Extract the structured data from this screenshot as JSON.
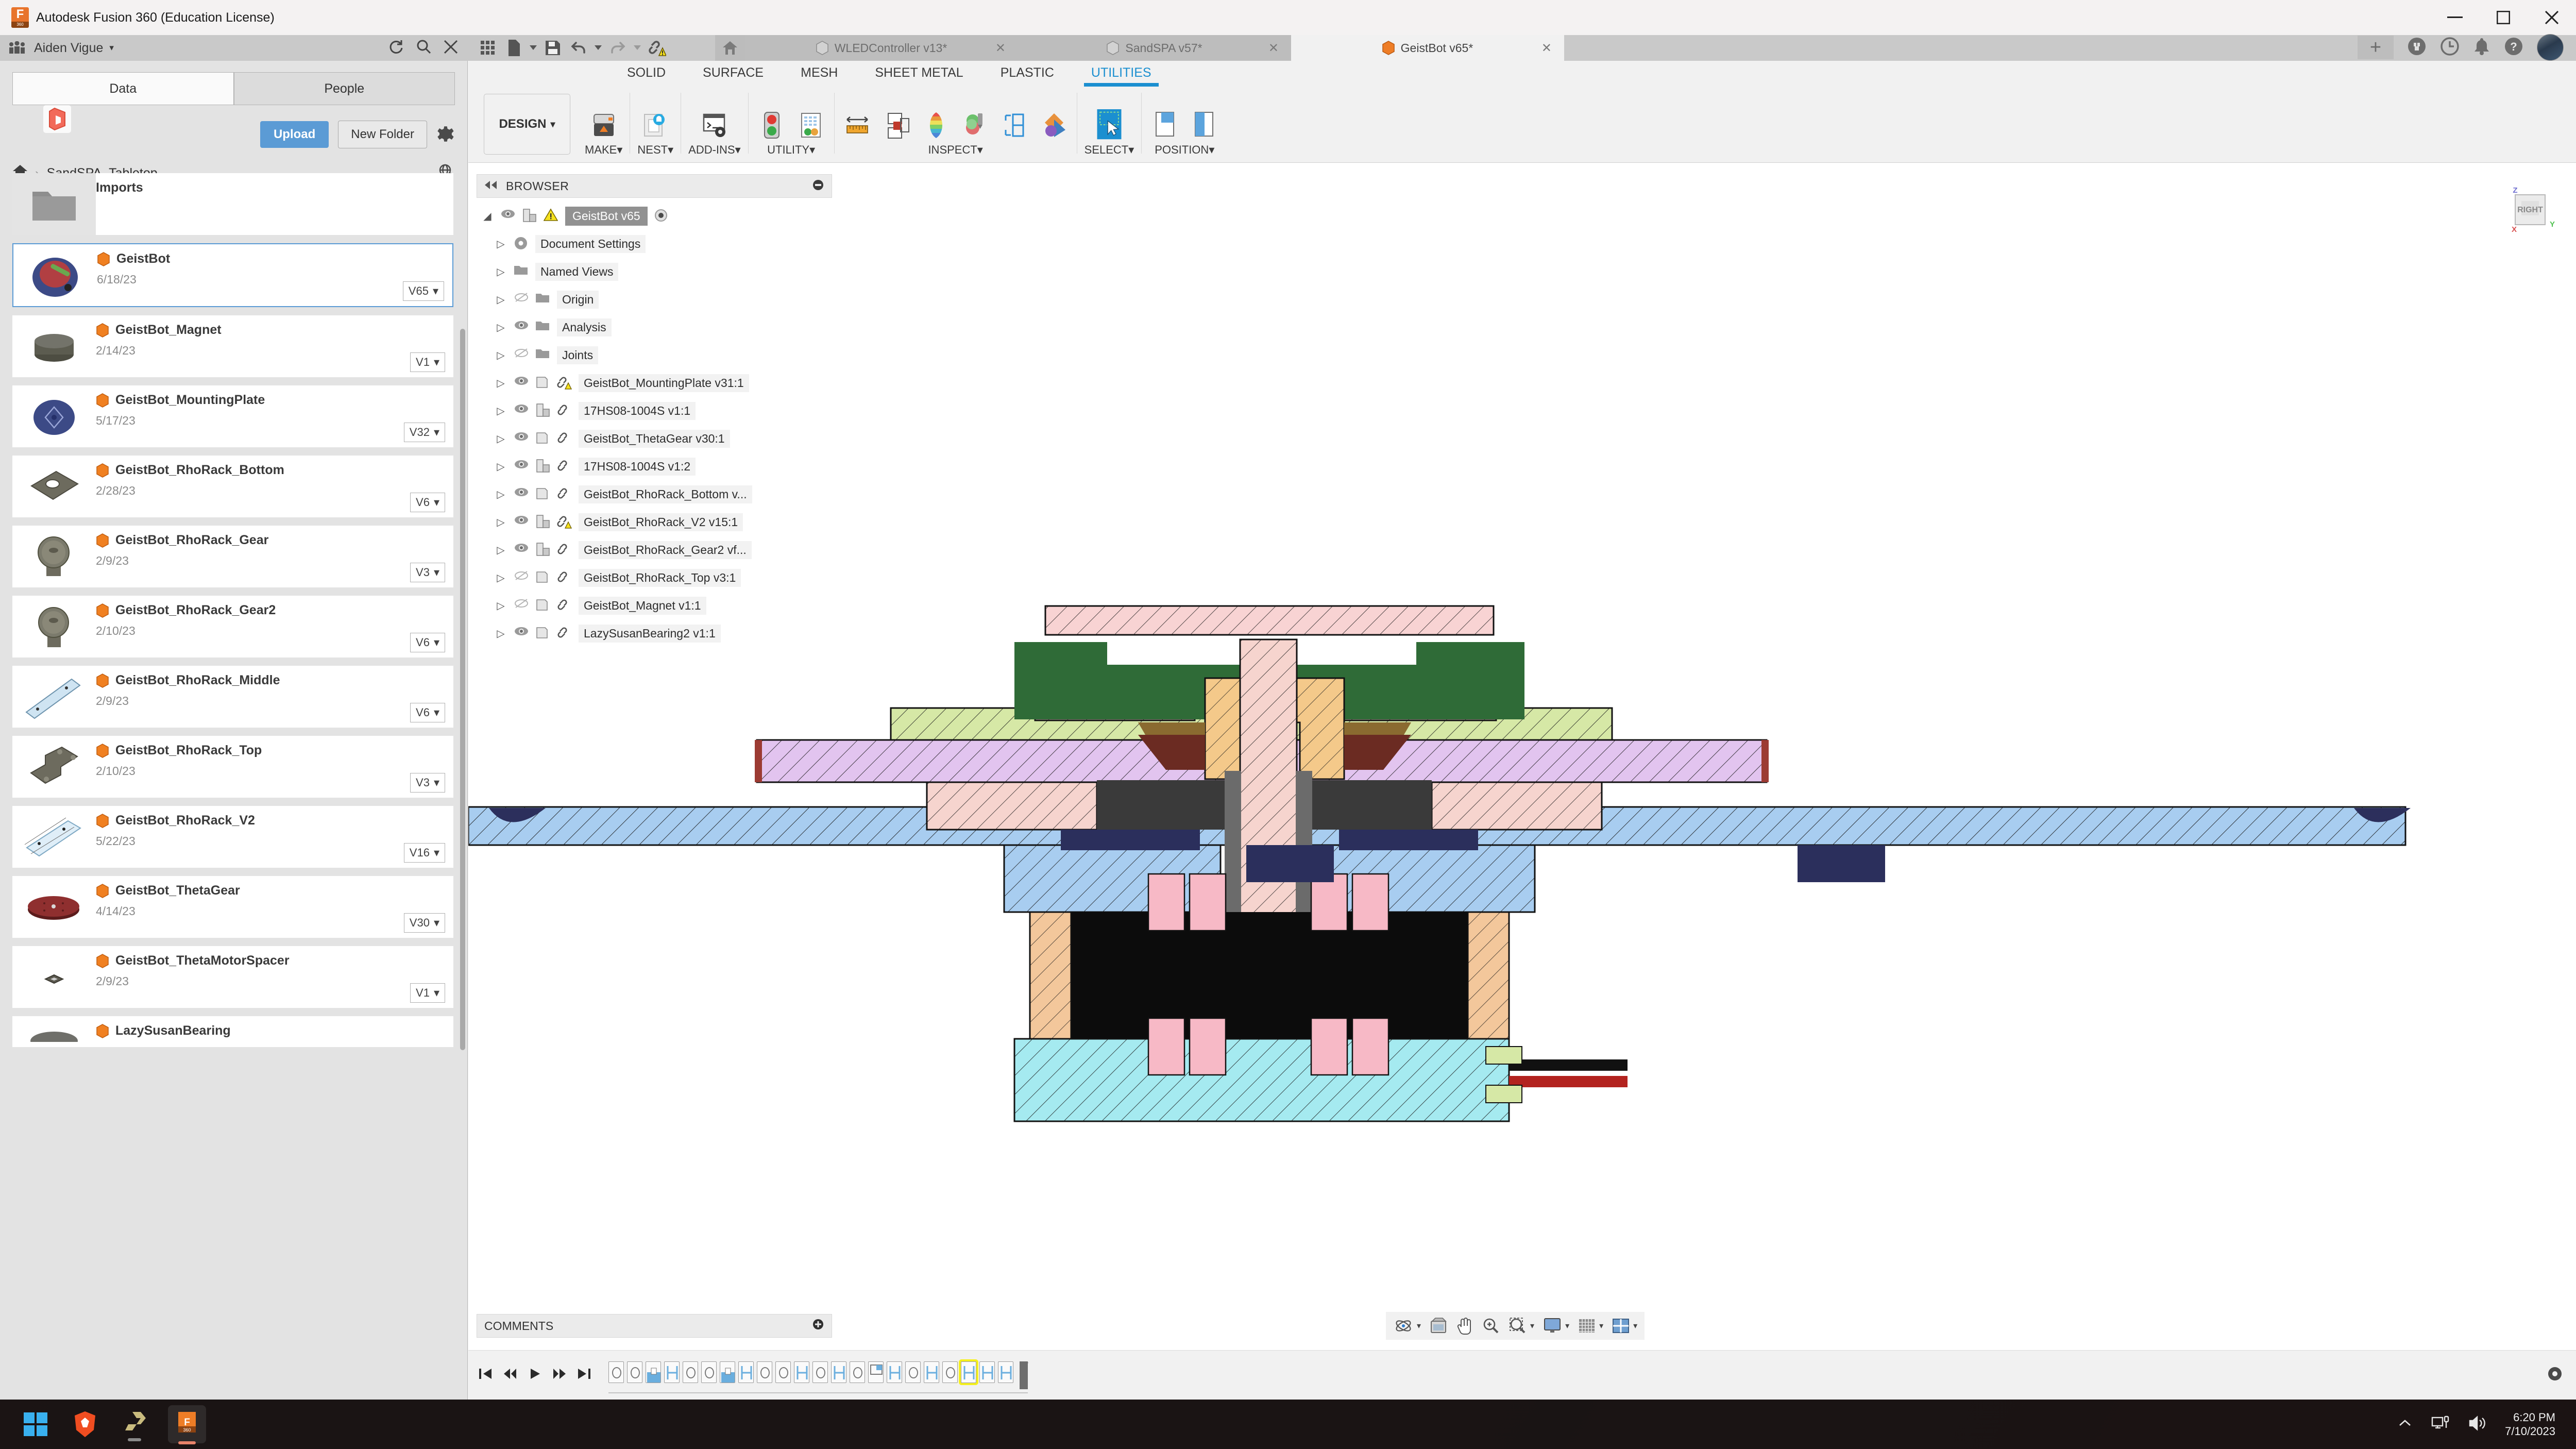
{
  "window": {
    "app_title": "Autodesk Fusion 360 (Education License)",
    "minimize_label": "Minimize",
    "maximize_label": "Maximize",
    "close_label": "Close"
  },
  "topbar": {
    "username": "Aiden Vigue",
    "user_caret": "▾",
    "refresh_label": "Refresh",
    "search_label": "Search",
    "close_panel_label": "Close Panel",
    "quick_access": [
      {
        "name": "grid-menu",
        "label": "Show Data Panel"
      },
      {
        "name": "file",
        "label": "File"
      },
      {
        "name": "save",
        "label": "Save"
      },
      {
        "name": "undo",
        "label": "Undo"
      },
      {
        "name": "redo",
        "label": "Redo"
      },
      {
        "name": "link-warning",
        "label": "Out of Date References"
      }
    ],
    "home_label": "Home",
    "tabs": [
      {
        "label": "WLEDController v13*",
        "active": false,
        "icon": "gray-cube",
        "closable": true
      },
      {
        "label": "SandSPA v57*",
        "active": false,
        "icon": "gray-cube",
        "closable": true
      },
      {
        "label": "GeistBot v65*",
        "active": true,
        "icon": "orange-cube",
        "closable": true
      }
    ],
    "new_tab_label": "+",
    "right_icons": [
      {
        "name": "extension-icon",
        "label": "Extensions"
      },
      {
        "name": "job-status-icon",
        "label": "Job Status"
      },
      {
        "name": "notification-bell-icon",
        "label": "Notifications"
      },
      {
        "name": "help-icon",
        "label": "Help"
      },
      {
        "name": "avatar",
        "label": "Account"
      }
    ]
  },
  "data_panel": {
    "tabs": [
      {
        "label": "Data",
        "active": true
      },
      {
        "label": "People",
        "active": false
      }
    ],
    "upload_label": "Upload",
    "new_folder_label": "New Folder",
    "settings_label": "Settings",
    "breadcrumb": {
      "home": "Home",
      "separator": "›",
      "current": "SandSPA_Tabletop"
    },
    "open_web_label": "Open details on web",
    "files": [
      {
        "name": "Imports",
        "date": "",
        "version": "",
        "type": "folder",
        "selected": false,
        "thumb": "folder"
      },
      {
        "name": "GeistBot",
        "date": "6/18/23",
        "version": "V65",
        "type": "design",
        "selected": true,
        "thumb": "assembly-blue-red"
      },
      {
        "name": "GeistBot_Magnet",
        "date": "2/14/23",
        "version": "V1",
        "type": "design",
        "selected": false,
        "thumb": "magnet-disc"
      },
      {
        "name": "GeistBot_MountingPlate",
        "date": "5/17/23",
        "version": "V32",
        "type": "design",
        "selected": false,
        "thumb": "plate-blue"
      },
      {
        "name": "GeistBot_RhoRack_Bottom",
        "date": "2/28/23",
        "version": "V6",
        "type": "design",
        "selected": false,
        "thumb": "bracket-gray"
      },
      {
        "name": "GeistBot_RhoRack_Gear",
        "date": "2/9/23",
        "version": "V3",
        "type": "design",
        "selected": false,
        "thumb": "gear"
      },
      {
        "name": "GeistBot_RhoRack_Gear2",
        "date": "2/10/23",
        "version": "V6",
        "type": "design",
        "selected": false,
        "thumb": "gear"
      },
      {
        "name": "GeistBot_RhoRack_Middle",
        "date": "2/9/23",
        "version": "V6",
        "type": "design",
        "selected": false,
        "thumb": "rail"
      },
      {
        "name": "GeistBot_RhoRack_Top",
        "date": "2/10/23",
        "version": "V3",
        "type": "design",
        "selected": false,
        "thumb": "l-bracket"
      },
      {
        "name": "GeistBot_RhoRack_V2",
        "date": "5/22/23",
        "version": "V16",
        "type": "design",
        "selected": false,
        "thumb": "rail-dimensioned"
      },
      {
        "name": "GeistBot_ThetaGear",
        "date": "4/14/23",
        "version": "V30",
        "type": "design",
        "selected": false,
        "thumb": "red-disc"
      },
      {
        "name": "GeistBot_ThetaMotorSpacer",
        "date": "2/9/23",
        "version": "V1",
        "type": "design",
        "selected": false,
        "thumb": "small-spacer"
      },
      {
        "name": "LazySusanBearing",
        "date": "",
        "version": "",
        "type": "design",
        "selected": false,
        "thumb": "bearing"
      }
    ]
  },
  "ribbon": {
    "tabs": [
      {
        "label": "SOLID",
        "active": false
      },
      {
        "label": "SURFACE",
        "active": false
      },
      {
        "label": "MESH",
        "active": false
      },
      {
        "label": "SHEET METAL",
        "active": false
      },
      {
        "label": "PLASTIC",
        "active": false
      },
      {
        "label": "UTILITIES",
        "active": true
      }
    ],
    "workspace_label": "DESIGN",
    "workspace_caret": "▾",
    "groups": [
      {
        "label": "MAKE",
        "caret": "▾",
        "icons": [
          {
            "name": "3d-print-icon"
          }
        ]
      },
      {
        "label": "NEST",
        "caret": "▾",
        "icons": [
          {
            "name": "arrange-icon"
          }
        ]
      },
      {
        "label": "ADD-INS",
        "caret": "▾",
        "icons": [
          {
            "name": "scripts-addins-icon"
          }
        ]
      },
      {
        "label": "UTILITY",
        "caret": "▾",
        "icons": [
          {
            "name": "model-state-icon"
          },
          {
            "name": "compute-all-icon"
          }
        ]
      },
      {
        "label": "INSPECT",
        "caret": "▾",
        "icons": [
          {
            "name": "measure-icon"
          },
          {
            "name": "section-analysis-icon"
          },
          {
            "name": "curvature-map-icon"
          },
          {
            "name": "interference-icon"
          },
          {
            "name": "component-color-cycle-icon"
          },
          {
            "name": "zebra-icon"
          }
        ]
      },
      {
        "label": "SELECT",
        "caret": "▾",
        "icons": [
          {
            "name": "selection-filter-icon"
          }
        ]
      },
      {
        "label": "POSITION",
        "caret": "▾",
        "icons": [
          {
            "name": "align-icon"
          },
          {
            "name": "move-icon"
          }
        ]
      }
    ]
  },
  "browser": {
    "title": "BROWSER",
    "collapse_label": "Collapse",
    "options_label": "Browser Options",
    "root": {
      "label": "GeistBot v65",
      "selected": true,
      "visible": true,
      "warning": true,
      "expanded": true
    },
    "items": [
      {
        "label": "Document Settings",
        "icon": "gear-icon",
        "visible": null,
        "link": false,
        "warning": false,
        "indent": 1
      },
      {
        "label": "Named Views",
        "icon": "folder-icon",
        "visible": null,
        "link": false,
        "warning": false,
        "indent": 1
      },
      {
        "label": "Origin",
        "icon": "folder-icon",
        "visible": false,
        "link": false,
        "warning": false,
        "indent": 1
      },
      {
        "label": "Analysis",
        "icon": "folder-icon",
        "visible": true,
        "link": false,
        "warning": false,
        "indent": 1
      },
      {
        "label": "Joints",
        "icon": "folder-icon",
        "visible": false,
        "link": false,
        "warning": false,
        "indent": 1
      },
      {
        "label": "GeistBot_MountingPlate v31:1",
        "icon": "body-icon",
        "visible": true,
        "link": true,
        "warning": true,
        "indent": 1
      },
      {
        "label": "17HS08-1004S v1:1",
        "icon": "component-icon",
        "visible": true,
        "link": true,
        "warning": false,
        "indent": 1
      },
      {
        "label": "GeistBot_ThetaGear v30:1",
        "icon": "body-icon",
        "visible": true,
        "link": true,
        "warning": false,
        "indent": 1
      },
      {
        "label": "17HS08-1004S v1:2",
        "icon": "component-icon",
        "visible": true,
        "link": true,
        "warning": false,
        "indent": 1
      },
      {
        "label": "GeistBot_RhoRack_Bottom v...",
        "icon": "body-icon",
        "visible": true,
        "link": true,
        "warning": false,
        "indent": 1
      },
      {
        "label": "GeistBot_RhoRack_V2 v15:1",
        "icon": "component-icon",
        "visible": true,
        "link": true,
        "warning": true,
        "indent": 1
      },
      {
        "label": "GeistBot_RhoRack_Gear2 vf...",
        "icon": "component-icon",
        "visible": true,
        "link": true,
        "warning": false,
        "indent": 1
      },
      {
        "label": "GeistBot_RhoRack_Top v3:1",
        "icon": "body-icon",
        "visible": false,
        "link": true,
        "warning": false,
        "indent": 1
      },
      {
        "label": "GeistBot_Magnet v1:1",
        "icon": "body-icon",
        "visible": false,
        "link": true,
        "warning": false,
        "indent": 1
      },
      {
        "label": "LazySusanBearing2 v1:1",
        "icon": "body-icon",
        "visible": true,
        "link": true,
        "warning": false,
        "indent": 1
      }
    ]
  },
  "viewport": {
    "viewcube": {
      "face": "RIGHT",
      "axis_z": "Z",
      "axis_x": "X",
      "axis_y": "Y"
    },
    "model_description": "Section analysis cross-section of GeistBot sand-drawing robot assembly"
  },
  "comments": {
    "title": "COMMENTS",
    "add_label": "Add comment"
  },
  "navbar": {
    "items": [
      {
        "name": "orbit-icon",
        "label": "Orbit",
        "caret": "▾"
      },
      {
        "name": "look-at-icon",
        "label": "Look At",
        "caret": ""
      },
      {
        "name": "pan-icon",
        "label": "Pan",
        "caret": ""
      },
      {
        "name": "zoom-icon",
        "label": "Zoom",
        "caret": ""
      },
      {
        "name": "zoom-window-icon",
        "label": "Fit",
        "caret": "▾"
      },
      {
        "name": "display-settings-icon",
        "label": "Display Settings",
        "caret": "▾"
      },
      {
        "name": "grid-snaps-icon",
        "label": "Grid and Snaps",
        "caret": "▾"
      },
      {
        "name": "viewports-icon",
        "label": "Viewports",
        "caret": "▾"
      }
    ]
  },
  "timeline": {
    "controls": [
      {
        "name": "go-to-beginning-icon",
        "label": "Go to beginning"
      },
      {
        "name": "step-back-icon",
        "label": "Step back"
      },
      {
        "name": "play-icon",
        "label": "Play"
      },
      {
        "name": "step-forward-icon",
        "label": "Step forward"
      },
      {
        "name": "go-to-end-icon",
        "label": "Go to end"
      }
    ],
    "features": [
      {
        "type": "sketch",
        "highlighted": false
      },
      {
        "type": "sketch",
        "highlighted": false
      },
      {
        "type": "extrude",
        "highlighted": false
      },
      {
        "type": "joint",
        "highlighted": false
      },
      {
        "type": "sketch",
        "highlighted": false
      },
      {
        "type": "sketch",
        "highlighted": false
      },
      {
        "type": "extrude",
        "highlighted": false
      },
      {
        "type": "joint",
        "highlighted": false
      },
      {
        "type": "sketch",
        "highlighted": false
      },
      {
        "type": "sketch",
        "highlighted": false
      },
      {
        "type": "joint",
        "highlighted": false
      },
      {
        "type": "sketch",
        "highlighted": false
      },
      {
        "type": "joint",
        "highlighted": false
      },
      {
        "type": "sketch",
        "highlighted": false
      },
      {
        "type": "plane",
        "highlighted": false
      },
      {
        "type": "joint",
        "highlighted": false
      },
      {
        "type": "sketch",
        "highlighted": false
      },
      {
        "type": "joint",
        "highlighted": false
      },
      {
        "type": "sketch",
        "highlighted": false
      },
      {
        "type": "joint",
        "highlighted": true
      },
      {
        "type": "joint",
        "highlighted": false
      },
      {
        "type": "joint",
        "highlighted": false
      }
    ],
    "settings_label": "Timeline Settings"
  },
  "taskbar": {
    "apps": [
      {
        "name": "start-button",
        "label": "Start",
        "active": false
      },
      {
        "name": "brave-browser",
        "label": "Brave",
        "active": false
      },
      {
        "name": "app-running",
        "label": "App",
        "active": false,
        "running": true
      },
      {
        "name": "fusion-360-taskbar",
        "label": "Fusion 360",
        "active": true,
        "running": true
      }
    ],
    "tray": [
      {
        "name": "show-hidden-icons",
        "label": "Show hidden icons",
        "glyph": "⌃"
      },
      {
        "name": "network-icon",
        "label": "Network"
      },
      {
        "name": "volume-icon",
        "label": "Volume"
      }
    ],
    "time": "6:20 PM",
    "date": "7/10/2023"
  },
  "colors": {
    "accent": "#1b8fd0",
    "upload_blue": "#5b9bd5",
    "orange": "#e8742c",
    "warning_yellow": "#f5e11e",
    "highlight_yellow": "#f5f01e"
  }
}
